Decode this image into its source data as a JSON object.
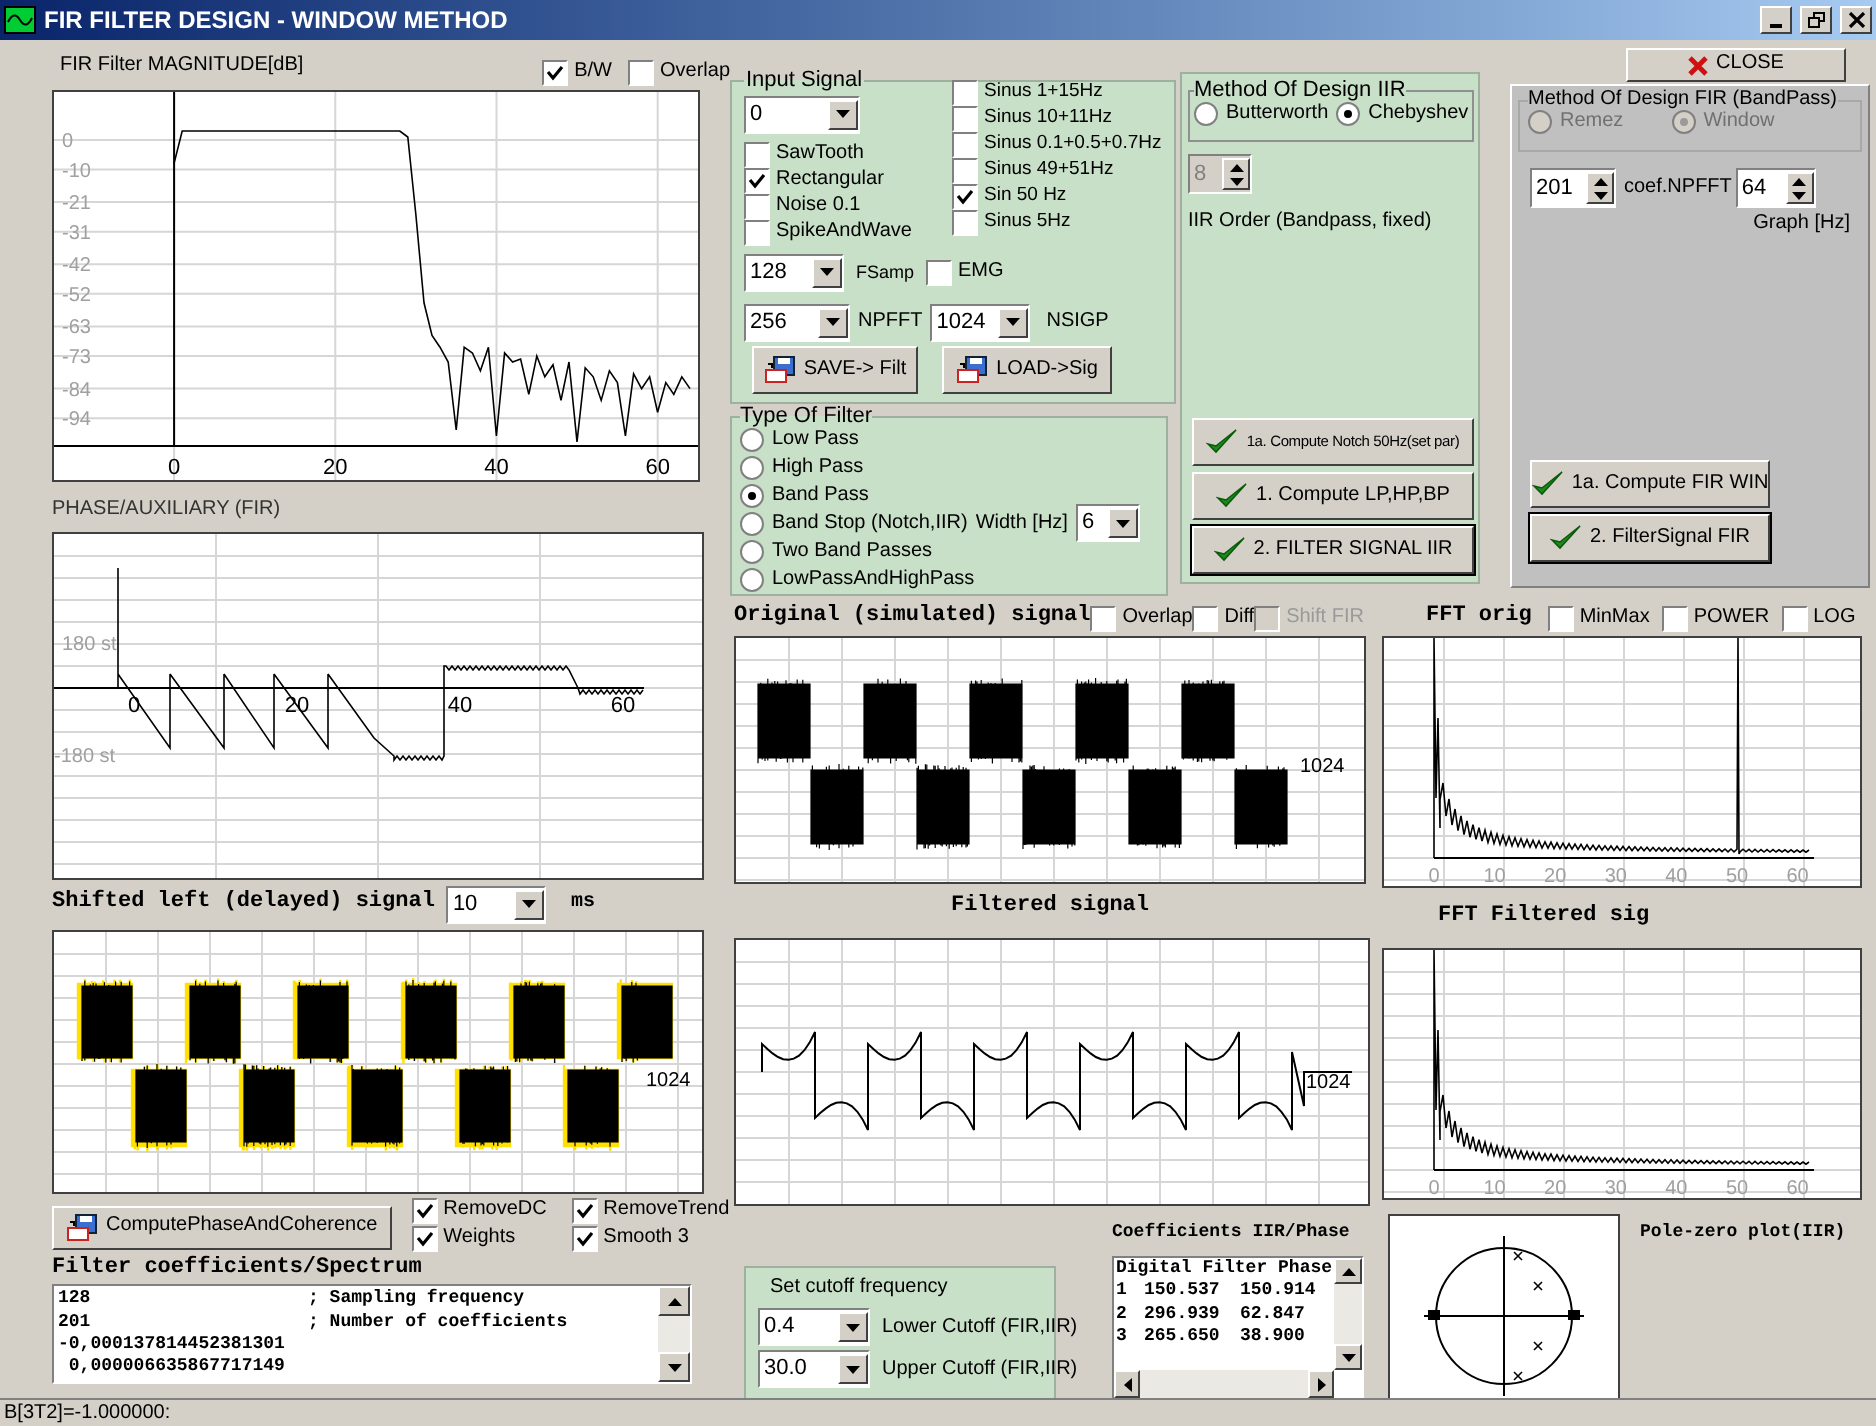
{
  "window": {
    "title": "FIR FILTER DESIGN - WINDOW METHOD"
  },
  "magnitude": {
    "title": "FIR Filter MAGNITUDE[dB]",
    "options": [
      {
        "label": "B/W",
        "checked": true
      },
      {
        "label": "Overlap",
        "checked": false
      }
    ],
    "chart_data": {
      "type": "line",
      "x": [
        0,
        1,
        2,
        3,
        4,
        5,
        6,
        7,
        8,
        9,
        10,
        11,
        12,
        13,
        14,
        15,
        16,
        17,
        18,
        19,
        20,
        21,
        22,
        23,
        24,
        25,
        26,
        27,
        28,
        29,
        30,
        31,
        32,
        33,
        34,
        35,
        36,
        37,
        38,
        39,
        40,
        41,
        42,
        43,
        44,
        45,
        46,
        47,
        48,
        49,
        50,
        51,
        52,
        53,
        54,
        55,
        56,
        57,
        58,
        59,
        60,
        61,
        62,
        63,
        64
      ],
      "series": [
        {
          "color": "#000000",
          "values": [
            -8,
            3,
            3,
            3,
            3,
            3,
            3,
            3,
            3,
            3,
            3,
            3,
            3,
            3,
            3,
            3,
            3,
            3,
            3,
            3,
            3,
            3,
            3,
            3,
            3,
            3,
            3,
            3,
            3,
            1,
            -25,
            -55,
            -66,
            -70,
            -75,
            -98,
            -70,
            -72,
            -78,
            -70,
            -100,
            -72,
            -75,
            -74,
            -86,
            -73,
            -80,
            -76,
            -88,
            -75,
            -102,
            -77,
            -80,
            -88,
            -78,
            -82,
            -100,
            -79,
            -84,
            -80,
            -92,
            -82,
            -86,
            -80,
            -84
          ]
        }
      ],
      "xticks": [
        0,
        20,
        40,
        60
      ],
      "yticks": [
        0,
        -10,
        -21,
        -31,
        -42,
        -52,
        -63,
        -73,
        -84,
        -94
      ],
      "xlim": [
        -14.9,
        65
      ],
      "ylim": [
        -103.4,
        16.2
      ],
      "grid": true
    }
  },
  "phase": {
    "title": "PHASE/AUXILIARY (FIR)",
    "y_tick_labels": [
      "180 st",
      "-180 st"
    ],
    "x_tick_labels": [
      "0",
      "20",
      "40",
      "60"
    ]
  },
  "shifted": {
    "title": "Shifted left (delayed) signal",
    "delay": "10",
    "unit": "ms",
    "trace_label": "1024"
  },
  "coherence_button": "ComputePhaseAndCoherence",
  "processing_options": [
    {
      "label": "RemoveDC",
      "checked": true
    },
    {
      "label": "RemoveTrend",
      "checked": true
    },
    {
      "label": "Weights",
      "checked": true
    },
    {
      "label": "Smooth 3",
      "checked": true
    }
  ],
  "coefficients": {
    "title": "Filter coefficients/Spectrum",
    "lines": [
      {
        "value": "128",
        "comment": "; Sampling frequency"
      },
      {
        "value": "201",
        "comment": "; Number of coefficients"
      },
      {
        "value": "-0,000137814452381301"
      },
      {
        "value": " 0,000006635867717149"
      }
    ]
  },
  "status_bar": "B[3T2]=-1.000000:",
  "input_signal": {
    "title": "Input Signal",
    "preset": "0",
    "waveforms": [
      {
        "label": "SawTooth",
        "checked": false
      },
      {
        "label": "Rectangular",
        "checked": true
      },
      {
        "label": "Noise 0.1",
        "checked": false
      },
      {
        "label": "SpikeAndWave",
        "checked": false
      }
    ],
    "sinusoids": [
      {
        "label": "Sinus 1+15Hz",
        "checked": false
      },
      {
        "label": "Sinus 10+11Hz",
        "checked": false
      },
      {
        "label": "Sinus 0.1+0.5+0.7Hz",
        "checked": false
      },
      {
        "label": "Sinus 49+51Hz",
        "checked": false
      },
      {
        "label": "Sin 50 Hz",
        "checked": true
      },
      {
        "label": "Sinus 5Hz",
        "checked": false
      }
    ],
    "fsamp": {
      "value": "128",
      "label": "FSamp"
    },
    "emg": {
      "label": "EMG",
      "checked": false
    },
    "npfft": {
      "value": "256",
      "label": "NPFFT"
    },
    "nsigp": {
      "value": "1024",
      "label": "NSIGP"
    },
    "save_button": "SAVE-> Filt",
    "load_button": "LOAD->Sig"
  },
  "filter_type": {
    "title": "Type Of Filter",
    "options": [
      {
        "label": "Low Pass",
        "selected": false
      },
      {
        "label": "High Pass",
        "selected": false
      },
      {
        "label": "Band Pass",
        "selected": true
      },
      {
        "label": "Band Stop (Notch,IIR)",
        "selected": false
      },
      {
        "label": "Two Band Passes",
        "selected": false
      },
      {
        "label": "LowPassAndHighPass",
        "selected": false
      }
    ],
    "width_label": "Width [Hz]",
    "width_value": "6"
  },
  "iir": {
    "title": "Method Of Design IIR",
    "methods": [
      {
        "label": "Butterworth",
        "selected": false
      },
      {
        "label": "Chebyshev",
        "selected": true
      }
    ],
    "order": "8",
    "order_label": "IIR Order (Bandpass, fixed)",
    "buttons": [
      {
        "label": "1a. Compute Notch 50Hz(set par)",
        "kind": "small"
      },
      {
        "label": "1. Compute LP,HP,BP",
        "kind": "normal"
      },
      {
        "label": "2. FILTER SIGNAL IIR",
        "kind": "double"
      }
    ]
  },
  "close_button": "CLOSE",
  "fir": {
    "title": "Method Of Design FIR (BandPass)",
    "methods": [
      {
        "label": "Remez",
        "selected": false
      },
      {
        "label": "Window",
        "selected": true
      }
    ],
    "methods_disabled": true,
    "coef": "201",
    "coef_label": "coef.NPFFT",
    "graph": "64",
    "graph_label": "Graph [Hz]",
    "buttons": [
      {
        "label": "1a. Compute FIR WIN",
        "kind": "normal"
      },
      {
        "label": "2. FilterSignal FIR",
        "kind": "double"
      }
    ]
  },
  "original": {
    "title": "Original (simulated) signal",
    "options": [
      {
        "label": "Overlap",
        "checked": false,
        "disabled": false
      },
      {
        "label": "Diff",
        "checked": false,
        "disabled": false
      },
      {
        "label": "Shift FIR",
        "checked": false,
        "disabled": true
      }
    ],
    "trace_label": "1024"
  },
  "fft_orig": {
    "title": "FFT orig",
    "options": [
      {
        "label": "MinMax",
        "checked": false
      },
      {
        "label": "POWER",
        "checked": false
      },
      {
        "label": "LOG",
        "checked": false
      }
    ],
    "x_tick_labels": [
      "0",
      "10",
      "20",
      "30",
      "40",
      "50",
      "60"
    ]
  },
  "filtered": {
    "title": "Filtered signal",
    "trace_label": "1024"
  },
  "fft_filtered": {
    "title": "FFT Filtered sig",
    "x_tick_labels": [
      "0",
      "10",
      "20",
      "30",
      "40",
      "50",
      "60"
    ]
  },
  "cutoff": {
    "title": "Set cutoff frequency",
    "rows": [
      {
        "value": "0.4",
        "label": "Lower Cutoff (FIR,IIR)"
      },
      {
        "value": "30.0",
        "label": "Upper Cutoff (FIR,IIR)"
      }
    ]
  },
  "iir_phase": {
    "title": "Coefficients IIR/Phase",
    "header": "Digital Filter Phase",
    "rows": [
      [
        "1",
        "150.537",
        "150.914"
      ],
      [
        "2",
        "296.939",
        "62.847"
      ],
      [
        "3",
        "265.650",
        "38.900"
      ]
    ]
  },
  "pole_zero": {
    "title": "Pole-zero plot(IIR)"
  }
}
